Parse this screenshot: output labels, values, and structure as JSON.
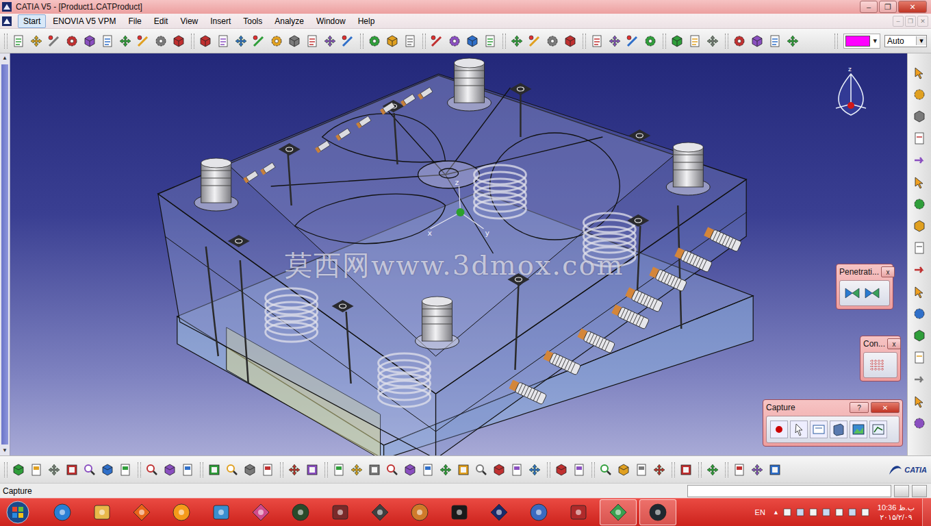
{
  "window": {
    "title": "CATIA V5 - [Product1.CATProduct]",
    "controls": [
      "–",
      "❐",
      "✕"
    ]
  },
  "menu": {
    "items": [
      {
        "label": "Start",
        "selected": true
      },
      {
        "label": "ENOVIA V5 VPM",
        "selected": false
      },
      {
        "label": "File",
        "selected": false
      },
      {
        "label": "Edit",
        "selected": false
      },
      {
        "label": "View",
        "selected": false
      },
      {
        "label": "Insert",
        "selected": false
      },
      {
        "label": "Tools",
        "selected": false
      },
      {
        "label": "Analyze",
        "selected": false
      },
      {
        "label": "Window",
        "selected": false
      },
      {
        "label": "Help",
        "selected": false
      }
    ],
    "doc_controls": [
      "–",
      "❐",
      "✕"
    ]
  },
  "toolbar": {
    "color_swatch": "#ff00ff",
    "swatch_arrow": "▾",
    "line_type": {
      "value": "Auto",
      "arrow": "▾"
    }
  },
  "viewport": {
    "watermark": "莫西网www.3dmox.com",
    "axis_labels": [
      "x",
      "y",
      "z"
    ],
    "compass_label": "z",
    "scrollbar": {
      "up": "▲",
      "down": "▼"
    }
  },
  "floating_toolbars": [
    {
      "title": "Penetrati...",
      "close": "x",
      "help": "",
      "kind": "penetration"
    },
    {
      "title": "Con...",
      "close": "x",
      "help": "",
      "kind": "constraint"
    },
    {
      "title": "Capture",
      "close": "✕",
      "help": "?",
      "kind": "capture"
    }
  ],
  "logo": {
    "text": "CATIA"
  },
  "status_bar": {
    "text": "Capture"
  },
  "taskbar": {
    "apps": [
      {
        "active": false
      },
      {
        "active": false
      },
      {
        "active": false
      },
      {
        "active": false
      },
      {
        "active": false
      },
      {
        "active": false
      },
      {
        "active": false
      },
      {
        "active": false
      },
      {
        "active": false
      },
      {
        "active": false
      },
      {
        "active": false
      },
      {
        "active": false
      },
      {
        "active": false
      },
      {
        "active": false
      },
      {
        "active": true
      },
      {
        "active": true
      }
    ],
    "language": "EN",
    "tray_arrow": "▲",
    "time": "10:36 ب.ظ",
    "date": "۲۰۱۵/۲/۰۹"
  }
}
